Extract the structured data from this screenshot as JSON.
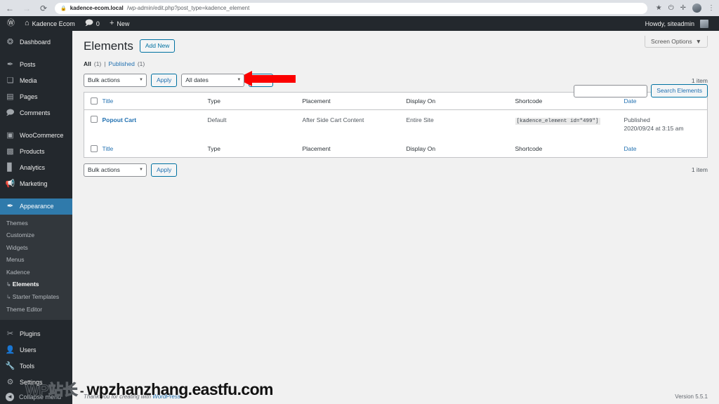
{
  "browser": {
    "back_icon": "back-arrow",
    "forward_icon": "forward-arrow",
    "reload_icon": "reload",
    "lock_icon": "lock",
    "url_host": "kadence-ecom.local",
    "url_path": "/wp-admin/edit.php?post_type=kadence_element",
    "star_icon": "★",
    "power_icon": "⏻",
    "extensions_icon": "✛",
    "menu_icon": "⋮"
  },
  "adminbar": {
    "wp_logo": "W",
    "site_icon": "⌂",
    "site_name": "Kadence Ecom",
    "comments_icon": "💬",
    "comments_count": "0",
    "new_icon": "+",
    "new_label": "New",
    "howdy": "Howdy, siteadmin"
  },
  "sidebar": {
    "items": [
      {
        "label": "Dashboard",
        "icon": "dashboard-icon",
        "glyph": "◉",
        "current": false
      },
      {
        "label": "Posts",
        "icon": "pin-icon",
        "glyph": "✎",
        "current": false
      },
      {
        "label": "Media",
        "icon": "media-icon",
        "glyph": "♫",
        "current": false
      },
      {
        "label": "Pages",
        "icon": "pages-icon",
        "glyph": "▤",
        "current": false
      },
      {
        "label": "Comments",
        "icon": "comments-icon",
        "glyph": "🗨",
        "current": false
      },
      {
        "label": "WooCommerce",
        "icon": "woocommerce-icon",
        "glyph": "▣",
        "current": false
      },
      {
        "label": "Products",
        "icon": "products-icon",
        "glyph": "▥",
        "current": false
      },
      {
        "label": "Analytics",
        "icon": "analytics-icon",
        "glyph": "▮",
        "current": false
      },
      {
        "label": "Marketing",
        "icon": "marketing-icon",
        "glyph": "►",
        "current": false
      },
      {
        "label": "Appearance",
        "icon": "appearance-icon",
        "glyph": "✎",
        "current": true
      },
      {
        "label": "Plugins",
        "icon": "plugins-icon",
        "glyph": "⚡",
        "current": false
      },
      {
        "label": "Users",
        "icon": "users-icon",
        "glyph": "👤",
        "current": false
      },
      {
        "label": "Tools",
        "icon": "tools-icon",
        "glyph": "🔧",
        "current": false
      },
      {
        "label": "Settings",
        "icon": "settings-icon",
        "glyph": "⚙",
        "current": false
      }
    ],
    "submenu": [
      {
        "label": "Themes",
        "active": false,
        "nested": false
      },
      {
        "label": "Customize",
        "active": false,
        "nested": false
      },
      {
        "label": "Widgets",
        "active": false,
        "nested": false
      },
      {
        "label": "Menus",
        "active": false,
        "nested": false
      },
      {
        "label": "Kadence",
        "active": false,
        "nested": false
      },
      {
        "label": "Elements",
        "active": true,
        "nested": true
      },
      {
        "label": "Starter Templates",
        "active": false,
        "nested": true
      },
      {
        "label": "Theme Editor",
        "active": false,
        "nested": false
      }
    ],
    "collapse_label": "Collapse menu",
    "collapse_icon": "◄",
    "highlight_color": "#2f7aab"
  },
  "content": {
    "screen_options_label": "Screen Options",
    "screen_options_caret": "▼",
    "page_title": "Elements",
    "add_new_label": "Add New",
    "views": {
      "all_label": "All",
      "all_count": "(1)",
      "divider": "|",
      "published_label": "Published",
      "published_count": "(1)"
    },
    "search": {
      "value": "",
      "placeholder": "",
      "button_label": "Search Elements"
    },
    "tablenav_top": {
      "bulk_actions": "Bulk actions",
      "apply_label": "Apply",
      "dates": "All dates",
      "filter_label": "Filter",
      "item_count": "1 item"
    },
    "tablenav_bottom": {
      "bulk_actions": "Bulk actions",
      "apply_label": "Apply",
      "item_count": "1 item"
    },
    "table": {
      "columns": [
        "Title",
        "Type",
        "Placement",
        "Display On",
        "Shortcode",
        "Date"
      ],
      "rows": [
        {
          "title": "Popout Cart",
          "type": "Default",
          "placement": "After Side Cart Content",
          "display_on": "Entire Site",
          "shortcode": "[kadence_element id=\"499\"]",
          "date_status": "Published",
          "date_value": "2020/09/24 at 3:15 am"
        }
      ]
    },
    "footer": {
      "thanks_prefix": "Thank you for creating with ",
      "wordpress_link": "WordPress",
      "thanks_suffix": ".",
      "version": "Version 5.5.1"
    }
  },
  "annotation": {
    "arrow_color": "#fc0000",
    "arrow_direction": "left"
  },
  "watermark": {
    "mark": "WP站长",
    "dash": "-",
    "domain": "wpzhanzhang.eastfu.com"
  }
}
